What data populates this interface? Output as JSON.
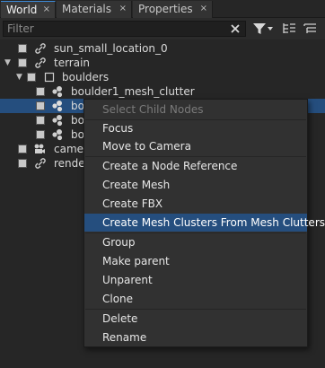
{
  "tabs": [
    {
      "label": "World",
      "close": "×",
      "active": true
    },
    {
      "label": "Materials",
      "close": "×",
      "active": false
    },
    {
      "label": "Properties",
      "close": "×",
      "active": false
    }
  ],
  "filter": {
    "placeholder": "Filter",
    "value": "",
    "clear_icon": "clear-icon",
    "filter_icon": "funnel-icon",
    "collapse_icon": "collapse-all-icon",
    "expand_icon": "expand-all-icon"
  },
  "tree": [
    {
      "label": "sun_small_location_0",
      "icon": "link-icon",
      "checked": true
    },
    {
      "label": "terrain",
      "icon": "link-icon",
      "checked": true,
      "expanded": true
    },
    {
      "label": "boulders",
      "icon": "empty-node-icon",
      "checked": true,
      "expanded": true
    },
    {
      "label": "boulder1_mesh_clutter",
      "icon": "mesh-clutter-icon",
      "checked": true
    },
    {
      "label": "bo",
      "icon": "mesh-clutter-icon",
      "checked": true,
      "selected": true
    },
    {
      "label": "bo",
      "icon": "mesh-clutter-icon",
      "checked": true
    },
    {
      "label": "bo",
      "icon": "mesh-clutter-icon",
      "checked": true
    },
    {
      "label": "camer",
      "icon": "camera-icon",
      "checked": true
    },
    {
      "label": "render",
      "icon": "link-icon",
      "checked": true
    }
  ],
  "context_menu": {
    "items": [
      {
        "label": "Select Child Nodes",
        "enabled": false
      },
      {
        "label": "Focus",
        "enabled": true
      },
      {
        "label": "Move to Camera",
        "enabled": true
      },
      {
        "label": "Create a Node Reference",
        "enabled": true
      },
      {
        "label": "Create Mesh",
        "enabled": true
      },
      {
        "label": "Create FBX",
        "enabled": true
      },
      {
        "label": "Create Mesh Clusters From Mesh Clutters",
        "enabled": true,
        "highlighted": true
      },
      {
        "label": "Group",
        "enabled": true
      },
      {
        "label": "Make parent",
        "enabled": true
      },
      {
        "label": "Unparent",
        "enabled": true
      },
      {
        "label": "Clone",
        "enabled": true
      },
      {
        "label": "Delete",
        "enabled": true
      },
      {
        "label": "Rename",
        "enabled": true
      }
    ]
  },
  "colors": {
    "background": "#262626",
    "panel": "#2b2b2b",
    "selection": "#254e7e",
    "accent": "#3c8ad8",
    "menu_background": "#313131"
  }
}
